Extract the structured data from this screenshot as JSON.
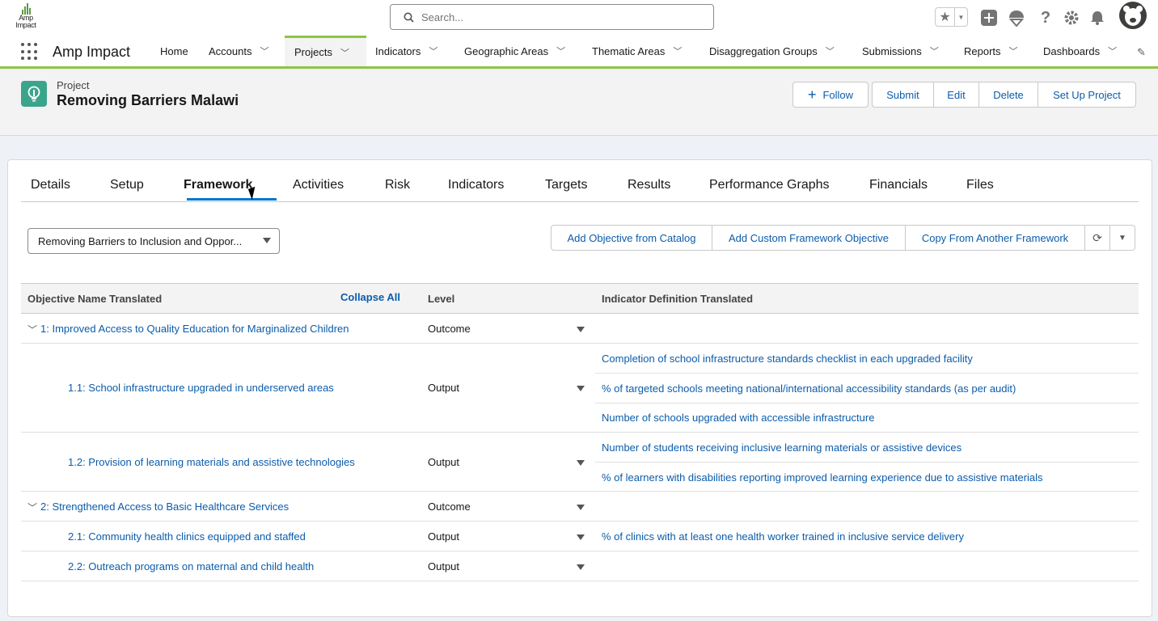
{
  "logo": {
    "line1": "Amp",
    "line2": "Impact"
  },
  "search": {
    "placeholder": "Search..."
  },
  "nav": {
    "app_name": "Amp Impact",
    "items": [
      {
        "label": "Home",
        "has_menu": false
      },
      {
        "label": "Accounts",
        "has_menu": true
      },
      {
        "label": "Projects",
        "has_menu": true,
        "active": true
      },
      {
        "label": "Indicators",
        "has_menu": true
      },
      {
        "label": "Geographic Areas",
        "has_menu": true
      },
      {
        "label": "Thematic Areas",
        "has_menu": true
      },
      {
        "label": "Disaggregation Groups",
        "has_menu": true
      },
      {
        "label": "Submissions",
        "has_menu": true
      },
      {
        "label": "Reports",
        "has_menu": true
      },
      {
        "label": "Dashboards",
        "has_menu": true
      }
    ]
  },
  "record": {
    "type_label": "Project",
    "title": "Removing Barriers Malawi",
    "buttons": {
      "follow": "Follow",
      "submit": "Submit",
      "edit": "Edit",
      "delete": "Delete",
      "setup": "Set Up Project"
    }
  },
  "tabs": [
    "Details",
    "Setup",
    "Framework",
    "Activities",
    "Risk",
    "Indicators",
    "Targets",
    "Results",
    "Performance Graphs",
    "Financials",
    "Files"
  ],
  "active_tab": "Framework",
  "framework": {
    "selected": "Removing Barriers to Inclusion and Oppor...",
    "actions": {
      "add_catalog": "Add Objective from Catalog",
      "add_custom": "Add Custom Framework Objective",
      "copy": "Copy From Another Framework"
    }
  },
  "table": {
    "headers": {
      "objective": "Objective Name Translated",
      "collapse_all": "Collapse All",
      "level": "Level",
      "indicator": "Indicator Definition Translated"
    },
    "rows": [
      {
        "objective": "1: Improved Access to Quality Education for Marginalized Children",
        "level": "Outcome",
        "depth": 0,
        "indicators": []
      },
      {
        "objective": "1.1: School infrastructure upgraded in underserved areas",
        "level": "Output",
        "depth": 1,
        "indicators": [
          "Completion of school infrastructure standards checklist in each upgraded facility",
          "% of targeted schools meeting national/international accessibility standards (as per audit)",
          "Number of schools upgraded with accessible infrastructure"
        ]
      },
      {
        "objective": "1.2: Provision of learning materials and assistive technologies",
        "level": "Output",
        "depth": 1,
        "indicators": [
          "Number of students receiving inclusive learning materials or assistive devices",
          "% of learners with disabilities reporting improved learning experience due to assistive materials"
        ]
      },
      {
        "objective": "2: Strengthened Access to Basic Healthcare Services",
        "level": "Outcome",
        "depth": 0,
        "indicators": []
      },
      {
        "objective": "2.1: Community health clinics equipped and staffed",
        "level": "Output",
        "depth": 1,
        "indicators": [
          "% of clinics with at least one health worker trained in inclusive service delivery"
        ]
      },
      {
        "objective": "2.2: Outreach programs on maternal and child health",
        "level": "Output",
        "depth": 1,
        "indicators": []
      }
    ]
  },
  "colors": {
    "brand_green": "#8cc63f",
    "link_blue": "#0b5cab",
    "record_icon": "#3ba58c"
  }
}
